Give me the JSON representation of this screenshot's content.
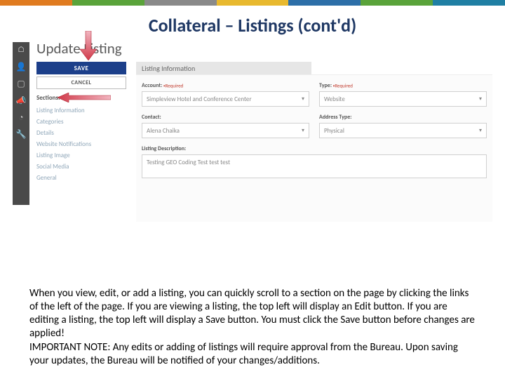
{
  "topbar_colors": [
    "#e07b1f",
    "#5aa33a",
    "#8a8a8a",
    "#e8b92f",
    "#2d6fa8",
    "#5aa33a",
    "#1f7fa3"
  ],
  "title": "Collateral – Listings (cont'd)",
  "panel_title": "Update Listing",
  "buttons": {
    "save": "SAVE",
    "cancel": "CANCEL"
  },
  "sections_label": "Sections:",
  "sections": [
    "Listing Information",
    "Categories",
    "Details",
    "Website Notifications",
    "Listing Image",
    "Social Media",
    "General"
  ],
  "info_header": "Listing Information",
  "fields": {
    "account": {
      "label": "Account:",
      "required": "Required",
      "value": "Simpleview Hotel and Conference Center"
    },
    "type": {
      "label": "Type:",
      "required": "Required",
      "value": "Website"
    },
    "contact": {
      "label": "Contact:",
      "value": "Alena Chaika"
    },
    "address_type": {
      "label": "Address Type:",
      "value": "Physical"
    },
    "description": {
      "label": "Listing Description:",
      "value": "Testing GEO Coding Test test test"
    }
  },
  "body_text": "When you view, edit, or add a listing, you can quickly scroll to a section on the page by clicking the links of the left of the page.  If you are viewing a listing, the top left will display an Edit button. If you are editing a listing, the top left will display a Save button. You must click the Save button before changes are applied!\nIMPORTANT NOTE:  Any edits or adding of listings will require approval from the Bureau. Upon saving your updates, the Bureau will be notified of your changes/additions."
}
